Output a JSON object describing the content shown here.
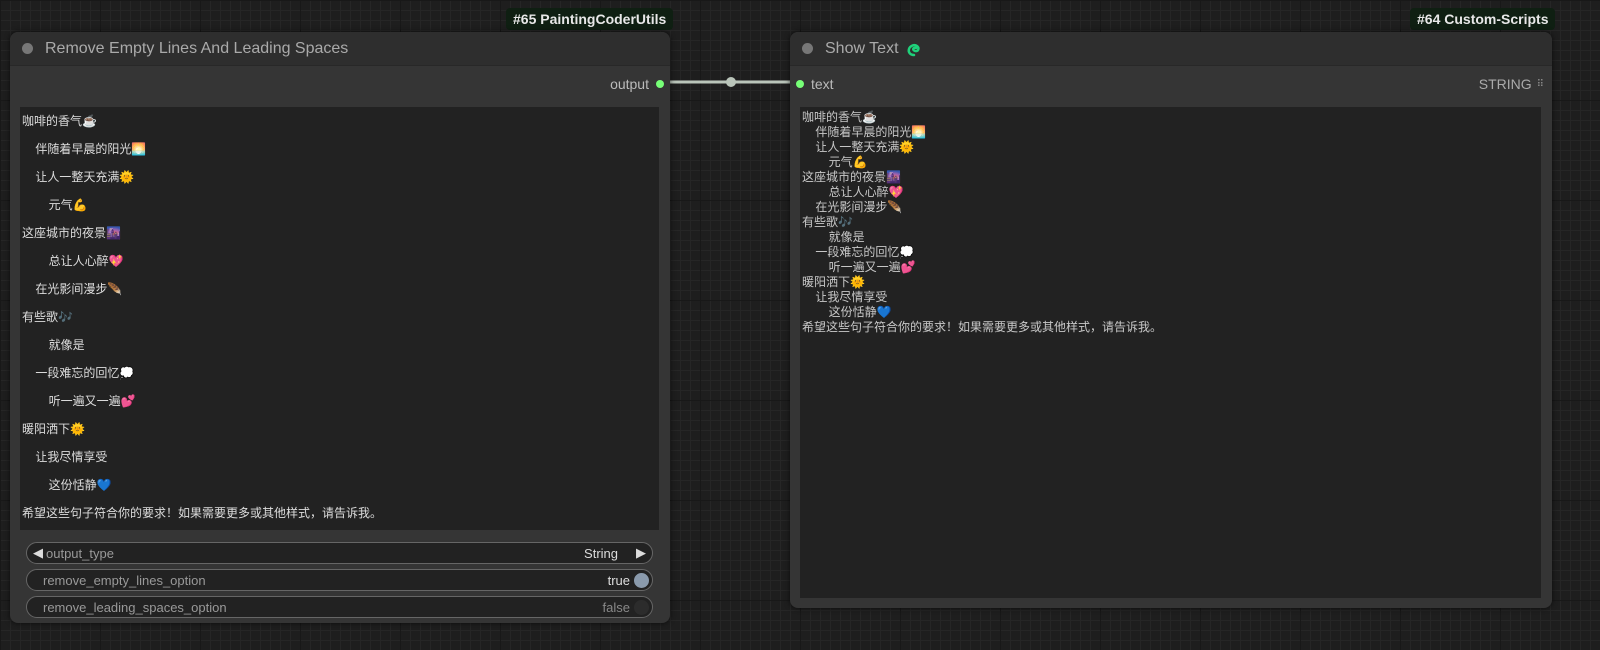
{
  "nodes": [
    {
      "badge": "#65 PaintingCoderUtils",
      "title": "Remove Empty Lines And Leading Spaces",
      "output_label": "output",
      "widgets": {
        "output_type": {
          "label": "output_type",
          "value": "String"
        },
        "remove_empty_lines_option": {
          "label": "remove_empty_lines_option",
          "value": "true"
        },
        "remove_leading_spaces_option": {
          "label": "remove_leading_spaces_option",
          "value": "false"
        }
      }
    },
    {
      "badge": "#64 Custom-Scripts",
      "title": "Show Text",
      "title_icon": "snake-icon",
      "input_label": "text",
      "type_label": "STRING"
    }
  ],
  "text_lines": [
    "咖啡的香气☕",
    "    伴随着早晨的阳光🌅",
    "    让人一整天充满🌞",
    "        元气💪",
    "这座城市的夜景🌆",
    "        总让人心醉💖",
    "    在光影间漫步🪶",
    "有些歌🎶",
    "        就像是",
    "    一段难忘的回忆💭",
    "        听一遍又一遍💕",
    "暖阳洒下🌞",
    "    让我尽情享受",
    "        这份恬静💙",
    "希望这些句子符合你的要求！如果需要更多或其他样式，请告诉我。"
  ],
  "colors": {
    "slot": "#77ff77",
    "link": "#b9c4b9",
    "toggle_on": "#8a9aac"
  }
}
